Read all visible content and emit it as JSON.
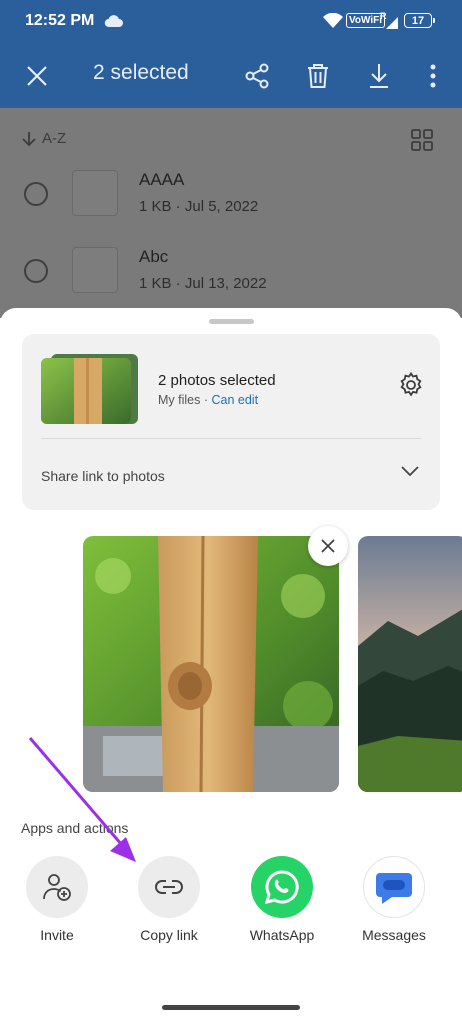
{
  "status_bar": {
    "time": "12:52 PM",
    "network": "VoWiFi",
    "signal_badge": "R",
    "battery": "17"
  },
  "app_bar": {
    "title": "2 selected"
  },
  "list": {
    "sort_label": "A-Z",
    "files": [
      {
        "name": "AAAA",
        "meta": "1 KB · Jul 5, 2022"
      },
      {
        "name": "Abc",
        "meta": "1 KB · Jul 13, 2022"
      }
    ]
  },
  "sheet": {
    "card": {
      "headline": "2 photos selected",
      "location": "My files · ",
      "permission": "Can edit",
      "share_option": "Share link to photos"
    },
    "apps_label": "Apps and actions",
    "apps": [
      {
        "label": "Invite",
        "icon": "invite-icon"
      },
      {
        "label": "Copy link",
        "icon": "link-icon"
      },
      {
        "label": "WhatsApp",
        "icon": "whatsapp-icon"
      },
      {
        "label": "Messages",
        "icon": "messages-icon"
      }
    ]
  },
  "colors": {
    "app_bar": "#2b5f9c",
    "whatsapp": "#25d366",
    "messages": "#3d7ce6",
    "annotation_arrow": "#9b30e8",
    "link": "#1f6fb8"
  }
}
